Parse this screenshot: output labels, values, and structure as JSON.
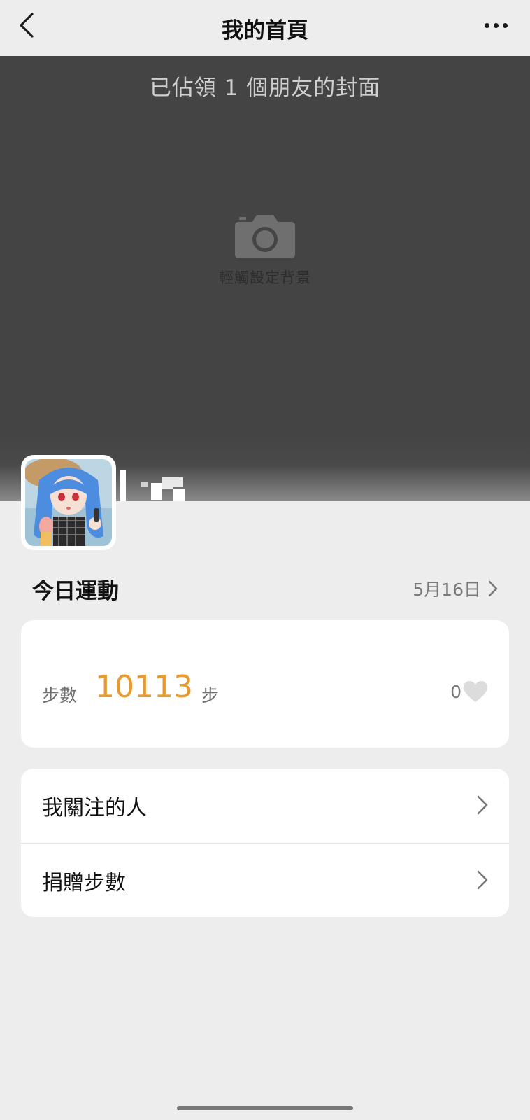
{
  "nav": {
    "title": "我的首頁",
    "back_icon": "chevron-left-icon",
    "more_icon": "more-horizontal-icon"
  },
  "cover": {
    "caption": "已佔領 1 個朋友的封面",
    "set_background_label": "輕觸設定背景",
    "camera_icon": "camera-icon"
  },
  "today": {
    "title": "今日運動",
    "date": "5月16日"
  },
  "steps": {
    "label": "步數",
    "value": "10113",
    "unit": "步",
    "likes_count": "0",
    "accent_color": "#e89a2c"
  },
  "menu": {
    "items": [
      {
        "label": "我關注的人"
      },
      {
        "label": "捐贈步數"
      }
    ]
  }
}
